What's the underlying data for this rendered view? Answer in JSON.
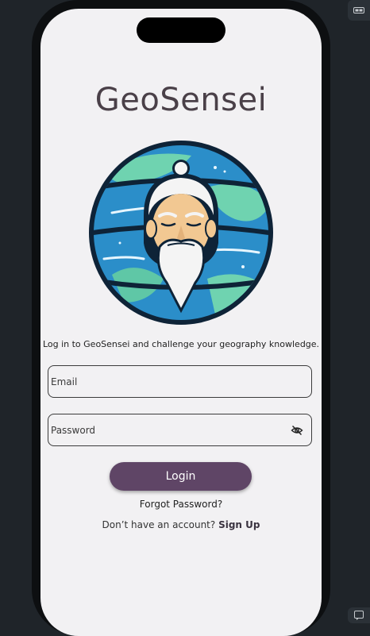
{
  "app": {
    "title": "GeoSensei"
  },
  "login": {
    "subtitle": "Log in to GeoSensei and challenge your geography knowledge.",
    "email_placeholder": "Email",
    "password_placeholder": "Password",
    "login_label": "Login",
    "forgot_label": "Forgot Password?",
    "no_account_text": "Don’t have an account?",
    "signup_label": "Sign Up"
  },
  "icons": {
    "logo": "sensei-globe-logo",
    "password_toggle": "eye-off-icon"
  },
  "colors": {
    "accent": "#5f4566",
    "screen_bg": "#f2f1f3",
    "title_text": "#4a4048"
  }
}
